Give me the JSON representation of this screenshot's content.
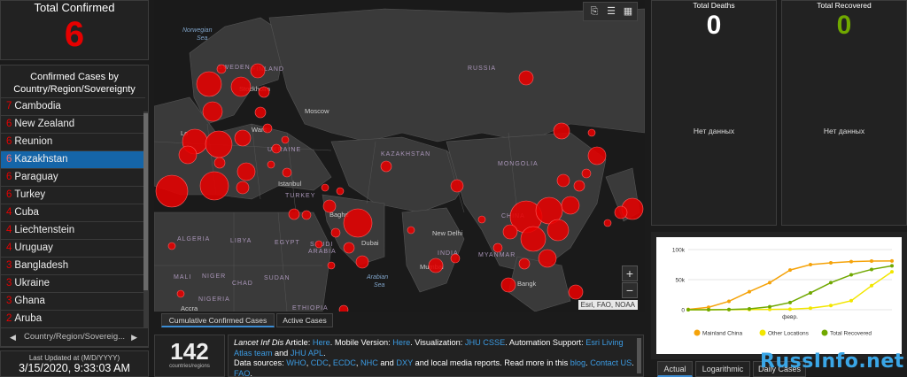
{
  "total": {
    "title": "Total Confirmed",
    "value": "6"
  },
  "list": {
    "title_line1": "Confirmed Cases by",
    "title_line2": "Country/Region/Sovereignty",
    "items": [
      {
        "num": "7",
        "name": "Cambodia"
      },
      {
        "num": "6",
        "name": "New Zealand"
      },
      {
        "num": "6",
        "name": "Reunion"
      },
      {
        "num": "6",
        "name": "Kazakhstan"
      },
      {
        "num": "6",
        "name": "Paraguay"
      },
      {
        "num": "6",
        "name": "Turkey"
      },
      {
        "num": "4",
        "name": "Cuba"
      },
      {
        "num": "4",
        "name": "Liechtenstein"
      },
      {
        "num": "4",
        "name": "Uruguay"
      },
      {
        "num": "3",
        "name": "Bangladesh"
      },
      {
        "num": "3",
        "name": "Ukraine"
      },
      {
        "num": "3",
        "name": "Ghana"
      },
      {
        "num": "2",
        "name": "Aruba"
      }
    ],
    "selected_index": 3,
    "pager_label": "Country/Region/Sovereig...",
    "pager_prev": "◀",
    "pager_next": "▶"
  },
  "updated": {
    "label": "Last Updated at (M/D/YYYY)",
    "value": "3/15/2020, 9:33:03 AM"
  },
  "map": {
    "tools": [
      "bookmark-icon",
      "list-icon",
      "qr-icon"
    ],
    "zoom_in": "+",
    "zoom_out": "−",
    "attribution": "Esri, FAO, NOAA",
    "tabs": [
      "Cumulative Confirmed Cases",
      "Active Cases"
    ],
    "labels": {
      "norwegian_sea": "Norwegian",
      "norwegian_sea_2": "Sea",
      "sweden": "SWEDEN",
      "finland": "FINLAND",
      "russia": "RUSSIA",
      "moscow": "Moscow",
      "ukraine": "UKRAINE",
      "kazakhstan": "KAZAKHSTAN",
      "mongolia": "MONGOLIA",
      "turkey": "TURKEY",
      "istanbul": "Istanbul",
      "china": "CHINA",
      "algeria": "ALGERIA",
      "libya": "LIBYA",
      "egypt": "EGYPT",
      "saudi": "SAUDI",
      "arabia": "ARABIA",
      "dubai": "Dubai",
      "new_delhi": "New Delhi",
      "india": "INDIA",
      "mumbai": "Mumbai",
      "myanmar": "MYANMAR",
      "mali": "MALI",
      "niger": "NIGER",
      "chad": "CHAD",
      "sudan": "SUDAN",
      "nigeria": "NIGERIA",
      "ethiopia": "ETHIOPIA",
      "arabian_sea": "Arabian",
      "arabian_sea_2": "Sea",
      "bangkok": "Bangk",
      "accra": "Accra",
      "stockholm": "Stockholm",
      "warsaw": "Wars",
      "london": "Lo",
      "baghdad": "Baghd"
    },
    "bubble_color": "#e60000"
  },
  "count": {
    "value": "142",
    "label": "countries/regions"
  },
  "info": {
    "p1_italic": "Lancet Inf Dis",
    "p1_a": " Article: ",
    "p1_here1": "Here",
    "p1_b": ". Mobile Version: ",
    "p1_here2": "Here",
    "p1_c": ". Visualization: ",
    "p1_jhu": "JHU CSSE",
    "p1_d": ". Automation Support: ",
    "p1_esri": "Esri Living Atlas team",
    "p1_e": " and ",
    "p1_jhuapl": "JHU APL",
    "p1_f": ".",
    "p2_a": "Data sources: ",
    "p2_who": "WHO",
    "p2_s1": ", ",
    "p2_cdc": "CDC",
    "p2_s2": ", ",
    "p2_ecdc": "ECDC",
    "p2_s3": ", ",
    "p2_nhc": "NHC",
    "p2_b": " and ",
    "p2_dxy": "DXY",
    "p2_c": " and local media reports. Read more in this ",
    "p2_blog": "blog",
    "p2_d": ". ",
    "p2_contact": "Contact US",
    "p2_e": ".",
    "p3_faq": "FAQ",
    "p3_e": "."
  },
  "deaths": {
    "title": "Total Deaths",
    "value": "0",
    "nodata": "Нет данных",
    "color": "#ffffff"
  },
  "recovered": {
    "title": "Total Recovered",
    "value": "0",
    "nodata": "Нет данных",
    "color": "#70a800"
  },
  "chart_data": {
    "type": "line",
    "xlabel": "",
    "ylabel": "",
    "x_tick_labels": [
      "февр."
    ],
    "y_tick_labels": [
      "0",
      "50k",
      "100k"
    ],
    "ylim": [
      0,
      100000
    ],
    "x": [
      0,
      5,
      10,
      15,
      20,
      25,
      30,
      35,
      40,
      45,
      50
    ],
    "series": [
      {
        "name": "Mainland China",
        "color": "#f5a30a",
        "values": [
          500,
          4000,
          14000,
          30000,
          45000,
          66000,
          75000,
          78000,
          80000,
          80800,
          81000
        ]
      },
      {
        "name": "Other Locations",
        "color": "#f2e600",
        "values": [
          0,
          50,
          150,
          400,
          600,
          1000,
          2500,
          7000,
          15000,
          40000,
          63000
        ]
      },
      {
        "name": "Total Recovered",
        "color": "#70a800",
        "values": [
          0,
          50,
          300,
          1500,
          5000,
          12000,
          28000,
          45000,
          58000,
          67000,
          73000
        ]
      }
    ],
    "legend_position": "bottom"
  },
  "chart_tabs": [
    "Actual",
    "Logarithmic",
    "Daily Cases"
  ],
  "watermark": "RussInfo.net"
}
